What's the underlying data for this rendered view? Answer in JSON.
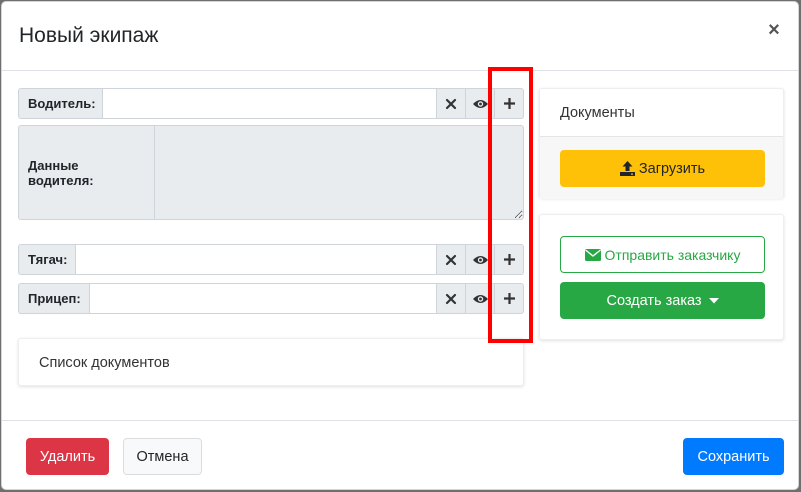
{
  "modal": {
    "title": "Новый экипаж",
    "close_label": "×"
  },
  "form": {
    "driver": {
      "label": "Водитель:",
      "value": ""
    },
    "driver_data": {
      "label": "Данные водителя:",
      "value": ""
    },
    "tractor": {
      "label": "Тягач:",
      "value": ""
    },
    "trailer": {
      "label": "Прицеп:",
      "value": ""
    },
    "field_icons": [
      "clear-icon",
      "view-icon",
      "plus-icon"
    ]
  },
  "documents_list": {
    "title": "Список документов"
  },
  "documents_card": {
    "title": "Документы",
    "upload_label": "Загрузить",
    "upload_icon": "upload-icon"
  },
  "actions_card": {
    "send_label": "Отправить заказчику",
    "send_icon": "envelope-icon",
    "create_order_label": "Создать заказ",
    "create_order_icon": "caret-down-icon"
  },
  "footer": {
    "delete_label": "Удалить",
    "cancel_label": "Отмена",
    "save_label": "Сохранить"
  },
  "colors": {
    "primary": "#007bff",
    "danger": "#dc3545",
    "success": "#28a745",
    "warning": "#ffc107",
    "highlight": "#ff0000"
  }
}
